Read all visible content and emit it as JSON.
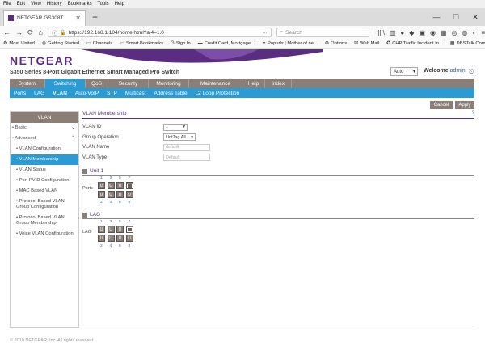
{
  "browser": {
    "menu": [
      "File",
      "Edit",
      "View",
      "History",
      "Bookmarks",
      "Tools",
      "Help"
    ],
    "tab_title": "NETGEAR GS308T",
    "url": "https://192.168.1.104/home.html?aj4=1.0",
    "search_placeholder": "Search",
    "bookmarks": [
      {
        "icon": "gear",
        "label": "Most Visited"
      },
      {
        "icon": "firefox",
        "label": "Getting Started"
      },
      {
        "icon": "folder",
        "label": "Channels"
      },
      {
        "icon": "folder",
        "label": "Smart Bookmarks"
      },
      {
        "icon": "g",
        "label": "Sign In"
      },
      {
        "icon": "card",
        "label": "Credit Card, Mortgage..."
      },
      {
        "icon": "paw",
        "label": "Popurls | Mother of ne..."
      },
      {
        "icon": "gear",
        "label": "Options"
      },
      {
        "icon": "mail",
        "label": "Web Mail"
      },
      {
        "icon": "chp",
        "label": "CHP Traffic Incident In..."
      },
      {
        "icon": "dbs",
        "label": "DBSTalk.Com"
      }
    ]
  },
  "header": {
    "logo": "NETGEAR",
    "product": "S350 Series 8-Port Gigabit Ethernet Smart Managed Pro Switch",
    "auto_select": "Auto",
    "welcome": "Welcome",
    "user": "admin"
  },
  "main_nav": [
    {
      "label": "System",
      "w": 44,
      "active": false
    },
    {
      "label": "Switching",
      "w": 50,
      "active": true
    },
    {
      "label": "QoS",
      "w": 28,
      "active": false
    },
    {
      "label": "Security",
      "w": 50,
      "active": false
    },
    {
      "label": "Monitoring",
      "w": 50,
      "active": false
    },
    {
      "label": "Maintenance",
      "w": 66,
      "active": false
    },
    {
      "label": "Help",
      "w": 28,
      "active": false
    },
    {
      "label": "Index",
      "w": 33,
      "active": false
    }
  ],
  "sub_nav": [
    "Ports",
    "LAG",
    "VLAN",
    "Auto-VoIP",
    "STP",
    "Multicast",
    "Address Table",
    "L2 Loop Protection"
  ],
  "buttons": {
    "cancel": "Cancel",
    "apply": "Apply"
  },
  "sidebar": {
    "title": "VLAN",
    "basic": "Basic",
    "advanced": "Advanced",
    "items": [
      "VLAN Configuration",
      "VLAN Membership",
      "VLAN Status",
      "Port PVID Configuration",
      "MAC Based VLAN",
      "Protocol Based VLAN Group Configuration",
      "Protocol Based VLAN Group Membership",
      "Voice VLAN Configuration"
    ]
  },
  "content": {
    "section_title": "VLAN Membership",
    "help": "?",
    "fields": {
      "vlan_id_label": "VLAN ID",
      "vlan_id_value": "1",
      "group_op_label": "Group Operation",
      "group_op_value": "UntTag All",
      "vlan_name_label": "VLAN Name",
      "vlan_name_value": "default",
      "vlan_type_label": "VLAN Type",
      "vlan_type_value": "Default"
    },
    "unit_title": "Unit 1",
    "ports_label": "Ports",
    "port_top_numbers": [
      "1",
      "3",
      "5",
      "7"
    ],
    "port_bottom_numbers": [
      "2",
      "4",
      "6",
      "8"
    ],
    "port_marker": "U",
    "lag_title": "LAG",
    "lag_label": "LAG",
    "lag_top_numbers": [
      "1",
      "3",
      "5",
      "7"
    ],
    "lag_bottom_numbers": [
      "2",
      "4",
      "6",
      "8"
    ]
  },
  "footer": "© 2019 NETGEAR, Inc. All rights reserved."
}
